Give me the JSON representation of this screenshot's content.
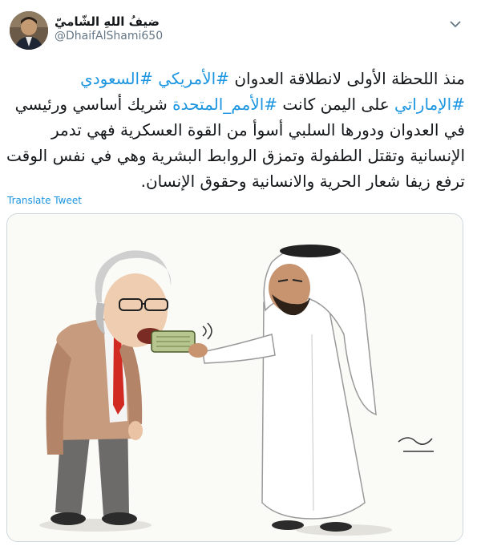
{
  "tweet": {
    "author_name": "ضيفُ اللهِ الشّاميّ",
    "author_handle": "@DhaifAlShami650",
    "body": {
      "t1": "منذ اللحظة الأولى لانطلاقة العدوان ",
      "h1": "#الأمريكي",
      "t2": " ",
      "h2": "#السعودي",
      "t3": " ",
      "h3": "#الإماراتي",
      "t4": " على اليمن كانت ",
      "h4": "#الأمم_المتحدة",
      "t5": " شريك أساسي ورئيسي في العدوان ودورها السلبي أسوأ من القوة العسكرية فهي تدمر الإنسانية وتقتل الطفولة وتمزق الروابط البشرية وهي في نفس الوقت ترفع زيفا شعار الحرية والانسانية وحقوق الإنسان."
    },
    "translate_label": "Translate Tweet"
  },
  "colors": {
    "link": "#1b95e0",
    "text": "#14171a",
    "muted": "#657786",
    "border": "#ccd6dd"
  },
  "icons": {
    "menu": "chevron-down-icon",
    "avatar": "avatar-photo"
  }
}
